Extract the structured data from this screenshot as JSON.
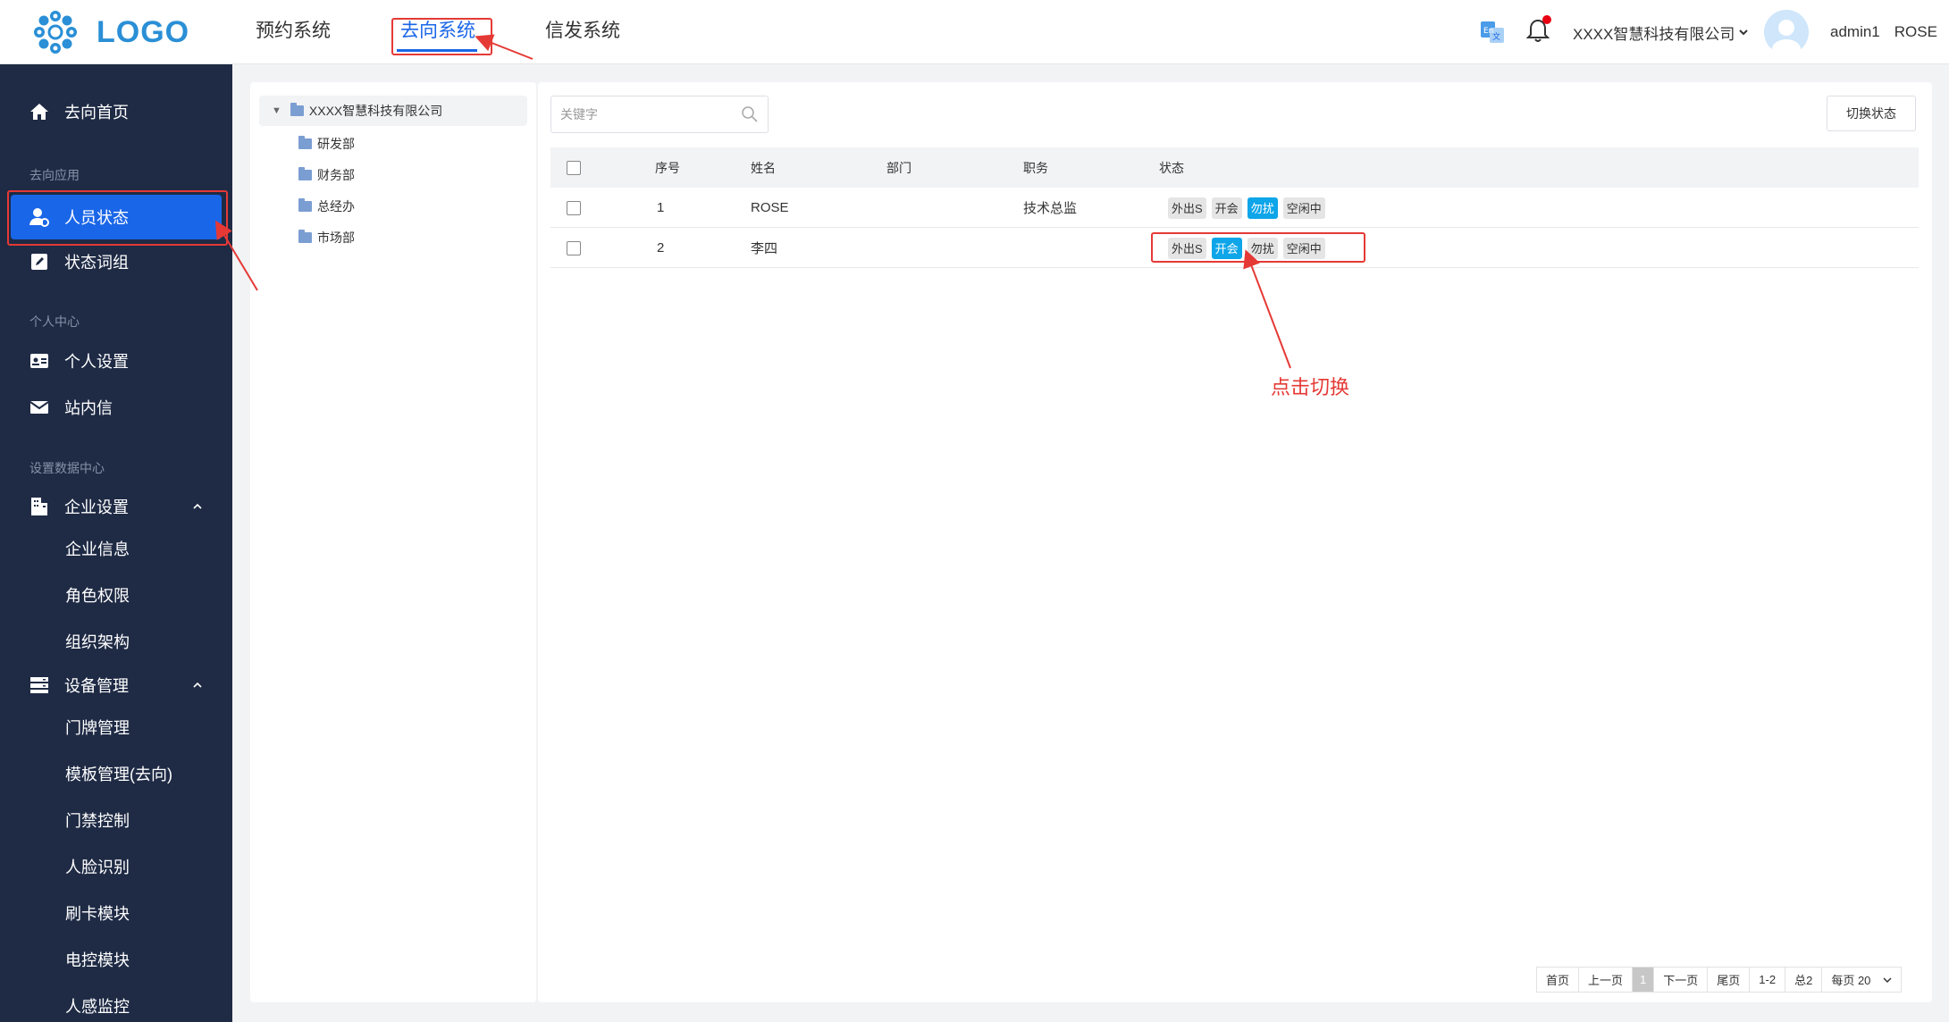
{
  "header": {
    "logo_text": "LOGO",
    "nav": [
      "预约系统",
      "去向系统",
      "信发系统"
    ],
    "active_nav": "去向系统",
    "company": "XXXX智慧科技有限公司",
    "username": "admin1",
    "display_name": "ROSE",
    "icons": [
      "translate-icon",
      "bell-icon",
      "chevron-down-icon",
      "avatar"
    ]
  },
  "sidebar": {
    "home": "去向首页",
    "group_app": "去向应用",
    "person_status": "人员状态",
    "status_words": "状态词组",
    "group_personal": "个人中心",
    "personal_settings": "个人设置",
    "inbox": "站内信",
    "group_data": "设置数据中心",
    "enterprise_settings": "企业设置",
    "enterprise_sub": [
      "企业信息",
      "角色权限",
      "组织架构"
    ],
    "device_mgmt": "设备管理",
    "device_sub": [
      "门牌管理",
      "模板管理(去向)",
      "门禁控制",
      "人脸识别",
      "刷卡模块",
      "电控模块",
      "人感监控"
    ]
  },
  "tree": {
    "root": "XXXX智慧科技有限公司",
    "children": [
      "研发部",
      "财务部",
      "总经办",
      "市场部"
    ]
  },
  "toolbar": {
    "search_placeholder": "关键字",
    "toggle_label": "切换状态"
  },
  "table": {
    "columns": [
      "序号",
      "姓名",
      "部门",
      "职务",
      "状态"
    ],
    "rows": [
      {
        "index": "1",
        "name": "ROSE",
        "dept": "",
        "title": "技术总监",
        "tags": [
          "外出S",
          "开会",
          "勿扰",
          "空闲中"
        ],
        "active": "勿扰"
      },
      {
        "index": "2",
        "name": "李四",
        "dept": "",
        "title": "",
        "tags": [
          "外出S",
          "开会",
          "勿扰",
          "空闲中"
        ],
        "active": "开会"
      }
    ]
  },
  "annotation": "点击切换",
  "pagination": {
    "first": "首页",
    "prev": "上一页",
    "current": "1",
    "next": "下一页",
    "last": "尾页",
    "range": "1-2",
    "total": "总2",
    "per_page": "每页 20"
  },
  "colors": {
    "primary": "#1a66e8",
    "sidebar_bg": "#1f2b45",
    "tag_active": "#0ea5e9",
    "annotation": "#e53935"
  }
}
